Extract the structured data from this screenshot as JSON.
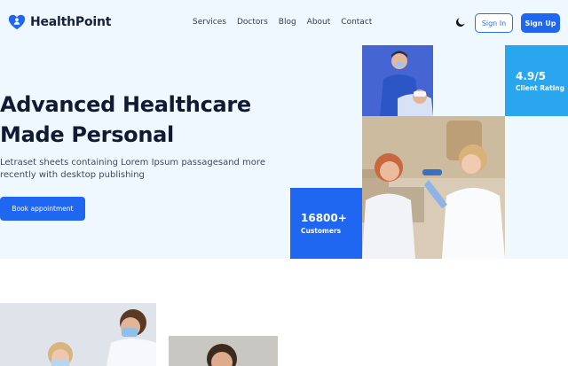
{
  "brand": {
    "name": "HealthPoint",
    "primary_color": "#1f66f0",
    "rating_color": "#2aa6ef",
    "hero_bg": "#f0f8ff"
  },
  "nav": {
    "items": [
      "Services",
      "Doctors",
      "Blog",
      "About",
      "Contact"
    ]
  },
  "header": {
    "theme_icon": "moon-icon",
    "signin_label": "Sign In",
    "signup_label": "Sign Up"
  },
  "hero": {
    "title_line1": "Advanced Healthcare",
    "title_line2": "Made Personal",
    "description": "Letraset sheets containing Lorem Ipsum passagesand more recently with desktop publishing",
    "cta_label": "Book appointment"
  },
  "stats": {
    "rating_value": "4.9/5",
    "rating_label": "Client Rating",
    "customers_value": "16800+",
    "customers_label": "Customers"
  }
}
